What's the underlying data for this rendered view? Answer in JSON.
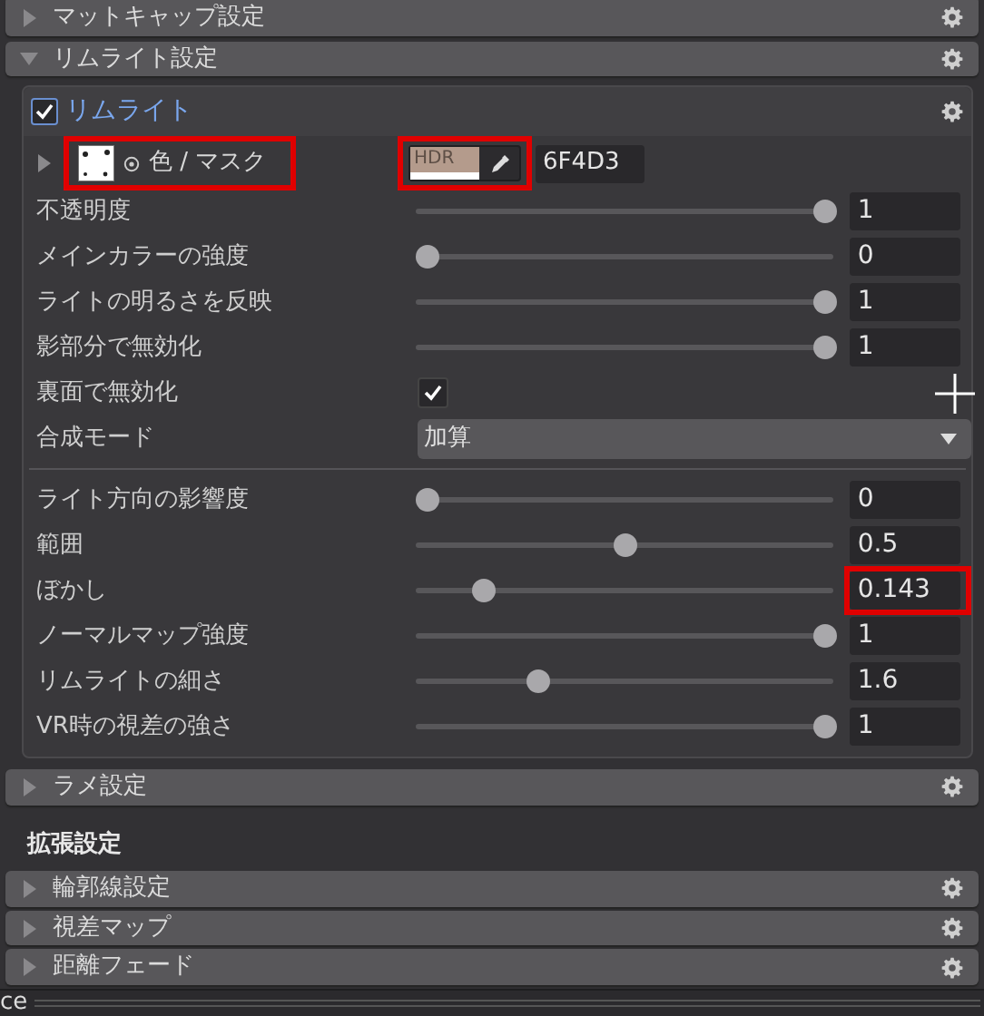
{
  "sections_top": [
    {
      "label": "マットキャップ設定",
      "expanded": false
    },
    {
      "label": "リムライト設定",
      "expanded": true
    }
  ],
  "rimlight": {
    "title": "リムライト",
    "checked": true,
    "color_row": {
      "label": "色 / マスク",
      "swatch_text": "HDR",
      "color": "#b49b8c",
      "hex": "6F4D3",
      "label_highlighted": true,
      "swatch_highlighted": true
    },
    "rows": [
      {
        "kind": "slider",
        "label": "不透明度",
        "level": 1,
        "value": "1",
        "highlighted": false
      },
      {
        "kind": "slider",
        "label": "メインカラーの強度",
        "level": 0,
        "value": "0",
        "highlighted": false
      },
      {
        "kind": "slider",
        "label": "ライトの明るさを反映",
        "level": 1,
        "value": "1",
        "highlighted": false
      },
      {
        "kind": "slider",
        "label": "影部分で無効化",
        "level": 1,
        "value": "1",
        "highlighted": false
      },
      {
        "kind": "checkbox",
        "label": "裏面で無効化",
        "checked": true
      },
      {
        "kind": "dropdown",
        "label": "合成モード",
        "value": "加算"
      },
      {
        "kind": "divider"
      },
      {
        "kind": "slider",
        "label": "ライト方向の影響度",
        "level": 0,
        "value": "0",
        "highlighted": false
      },
      {
        "kind": "slider",
        "label": "範囲",
        "level": 0.5,
        "value": "0.5",
        "highlighted": false
      },
      {
        "kind": "slider",
        "label": "ぼかし",
        "level": 0.143,
        "value": "0.143",
        "highlighted": true
      },
      {
        "kind": "slider",
        "label": "ノーマルマップ強度",
        "level": 1,
        "value": "1",
        "highlighted": false
      },
      {
        "kind": "slider",
        "label": "リムライトの細さ",
        "level": 0.28,
        "value": "1.6",
        "highlighted": false
      },
      {
        "kind": "slider",
        "label": "VR時の視差の強さ",
        "level": 1,
        "value": "1",
        "highlighted": false
      }
    ]
  },
  "sections_middle": [
    {
      "label": "ラメ設定",
      "expanded": false
    }
  ],
  "extended_heading": "拡張設定",
  "sections_bottom": [
    {
      "label": "輪郭線設定",
      "expanded": false
    },
    {
      "label": "視差マップ",
      "expanded": false
    },
    {
      "label": "距離フェード",
      "expanded": false
    }
  ],
  "footer_label": "ce"
}
